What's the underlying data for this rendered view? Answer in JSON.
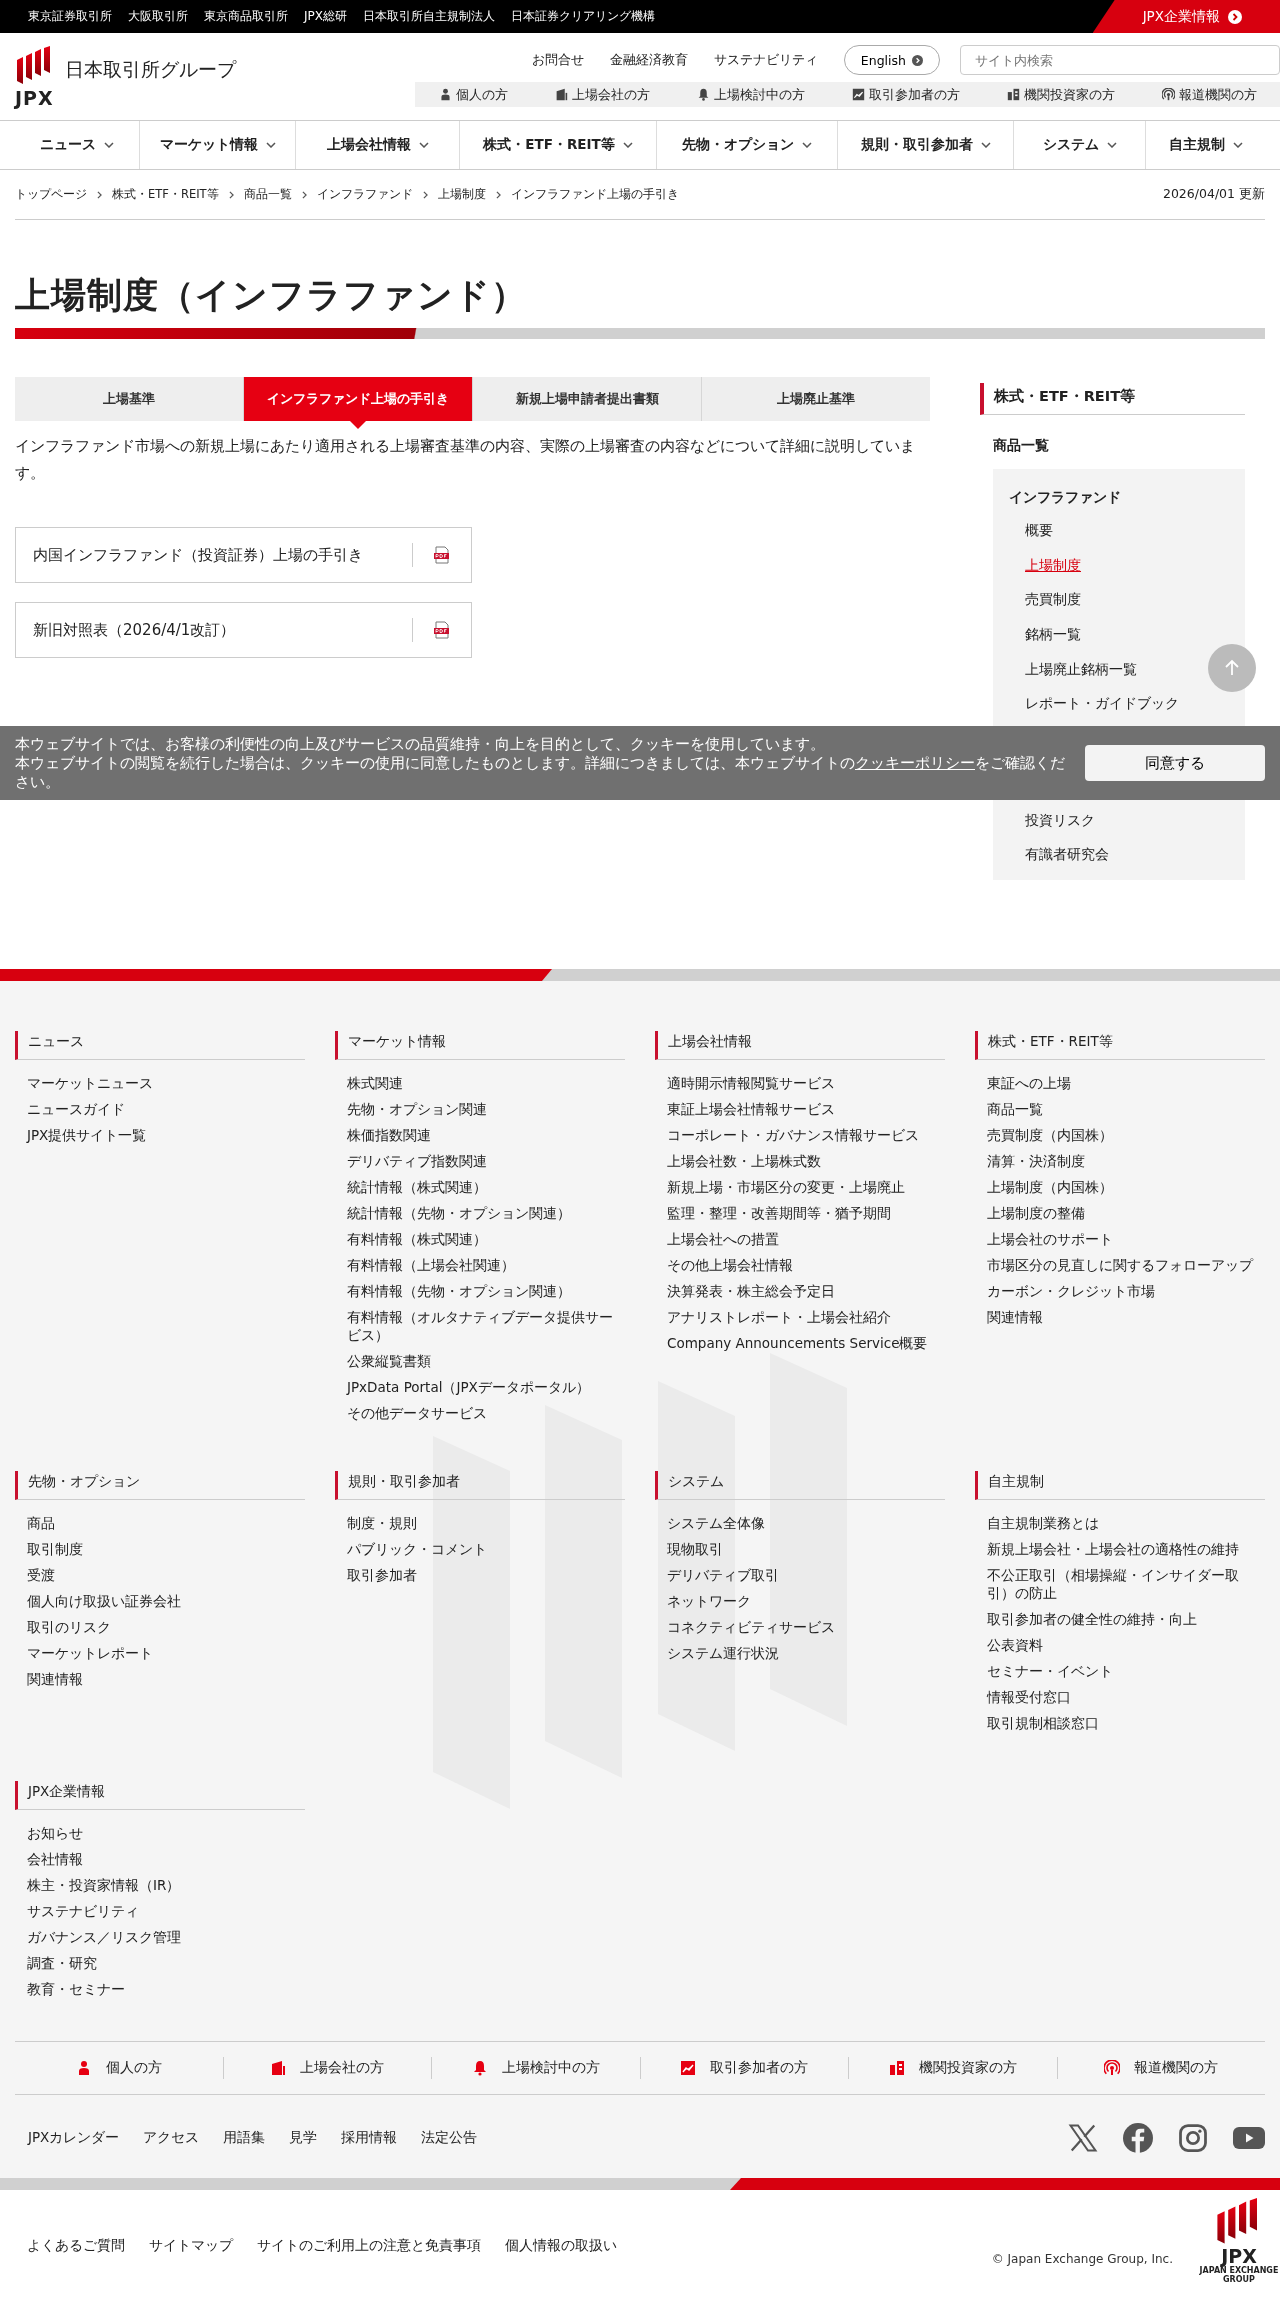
{
  "top_bar": {
    "links": [
      "東京証券取引所",
      "大阪取引所",
      "東京商品取引所",
      "JPX総研",
      "日本取引所自主規制法人",
      "日本証券クリアリング機構"
    ],
    "corporate_link": "JPX企業情報"
  },
  "header": {
    "logo_text": "JPX",
    "group_name": "日本取引所グループ",
    "utility_links": [
      "お問合せ",
      "金融経済教育",
      "サステナビリティ"
    ],
    "language_button": "English",
    "search": {
      "placeholder": "サイト内検索"
    },
    "audience_links": [
      {
        "label": "個人の方",
        "kind": "person"
      },
      {
        "label": "上場会社の方",
        "kind": "building"
      },
      {
        "label": "上場検討中の方",
        "kind": "bell"
      },
      {
        "label": "取引参加者の方",
        "kind": "chart"
      },
      {
        "label": "機関投資家の方",
        "kind": "institution"
      },
      {
        "label": "報道機関の方",
        "kind": "broadcast"
      }
    ]
  },
  "main_nav": [
    "ニュース",
    "マーケット情報",
    "上場会社情報",
    "株式・ETF・REIT等",
    "先物・オプション",
    "規則・取引参加者",
    "システム",
    "自主規制"
  ],
  "breadcrumb": [
    "トップページ",
    "株式・ETF・REIT等",
    "商品一覧",
    "インフラファンド",
    "上場制度",
    "インフラファンド上場の手引き"
  ],
  "updated": "2026/04/01 更新",
  "page_title": "上場制度（インフラファンド）",
  "tabs": [
    {
      "label": "上場基準",
      "selected": false
    },
    {
      "label": "インフラファンド上場の手引き",
      "selected": true
    },
    {
      "label": "新規上場申請者提出書類",
      "selected": false
    },
    {
      "label": "上場廃止基準",
      "selected": false
    }
  ],
  "description": "インフラファンド市場への新規上場にあたり適用される上場審査基準の内容、実際の上場審査の内容などについて詳細に説明しています。",
  "documents": [
    {
      "title": "内国インフラファンド（投資証券）上場の手引き"
    },
    {
      "title": "新旧対照表（2026/4/1改訂）"
    }
  ],
  "sidebar": {
    "heading": "株式・ETF・REIT等",
    "items": [
      {
        "label": "商品一覧",
        "children": [
          {
            "label": "インフラファンド",
            "children": [
              {
                "label": "概要",
                "selected": false
              },
              {
                "label": "上場制度",
                "selected": true
              },
              {
                "label": "売買制度",
                "selected": false
              },
              {
                "label": "銘柄一覧",
                "selected": false
              },
              {
                "label": "上場廃止銘柄一覧",
                "selected": false
              },
              {
                "label": "レポート・ガイドブック",
                "selected": false
              },
              {
                "label": "投資リスク",
                "selected": false
              },
              {
                "label": "有識者研究会",
                "selected": false
              }
            ]
          }
        ]
      }
    ]
  },
  "cookie_banner": {
    "sentence": "本ウェブサイトでは、お客様の利便性の向上及びサービスの品質維持・向上を目的として、クッキーを使用しています。",
    "before_link": "本ウェブサイトの閲覧を続行した場合は、クッキーの使用に同意したものとします。詳細につきましては、本ウェブサイトの",
    "link": "クッキーポリシー",
    "after_link": "をご確認ください。",
    "agree_button": "同意する"
  },
  "footer": {
    "sitemap": [
      {
        "heading": "ニュース",
        "links": [
          "マーケットニュース",
          "ニュースガイド",
          "JPX提供サイト一覧"
        ]
      },
      {
        "heading": "マーケット情報",
        "links": [
          "株式関連",
          "先物・オプション関連",
          "株価指数関連",
          "デリバティブ指数関連",
          "統計情報（株式関連）",
          "統計情報（先物・オプション関連）",
          "有料情報（株式関連）",
          "有料情報（上場会社関連）",
          "有料情報（先物・オプション関連）",
          "有料情報（オルタナティブデータ提供サービス）",
          "公衆縦覧書類",
          "JPxData Portal（JPXデータポータル）",
          "その他データサービス"
        ]
      },
      {
        "heading": "上場会社情報",
        "links": [
          "適時開示情報閲覧サービス",
          "東証上場会社情報サービス",
          "コーポレート・ガバナンス情報サービス",
          "上場会社数・上場株式数",
          "新規上場・市場区分の変更・上場廃止",
          "監理・整理・改善期間等・猶予期間",
          "上場会社への措置",
          "その他上場会社情報",
          "決算発表・株主総会予定日",
          "アナリストレポート・上場会社紹介",
          "Company Announcements Service概要"
        ]
      },
      {
        "heading": "株式・ETF・REIT等",
        "links": [
          "東証への上場",
          "商品一覧",
          "売買制度（内国株）",
          "清算・決済制度",
          "上場制度（内国株）",
          "上場制度の整備",
          "上場会社のサポート",
          "市場区分の見直しに関するフォローアップ",
          "カーボン・クレジット市場",
          "関連情報"
        ]
      },
      {
        "heading": "先物・オプション",
        "links": [
          "商品",
          "取引制度",
          "受渡",
          "個人向け取扱い証券会社",
          "取引のリスク",
          "マーケットレポート",
          "関連情報"
        ]
      },
      {
        "heading": "規則・取引参加者",
        "links": [
          "制度・規則",
          "パブリック・コメント",
          "取引参加者"
        ]
      },
      {
        "heading": "システム",
        "links": [
          "システム全体像",
          "現物取引",
          "デリバティブ取引",
          "ネットワーク",
          "コネクティビティサービス",
          "システム運行状況"
        ]
      },
      {
        "heading": "自主規制",
        "links": [
          "自主規制業務とは",
          "新規上場会社・上場会社の適格性の維持",
          "不公正取引（相場操縦・インサイダー取引）の防止",
          "取引参加者の健全性の維持・向上",
          "公表資料",
          "セミナー・イベント",
          "情報受付窓口",
          "取引規制相談窓口"
        ]
      },
      {
        "heading": "JPX企業情報",
        "links": [
          "お知らせ",
          "会社情報",
          "株主・投資家情報（IR）",
          "サステナビリティ",
          "ガバナンス／リスク管理",
          "調査・研究",
          "教育・セミナー"
        ]
      }
    ],
    "audience_links": [
      {
        "label": "個人の方",
        "kind": "person"
      },
      {
        "label": "上場会社の方",
        "kind": "building"
      },
      {
        "label": "上場検討中の方",
        "kind": "bell"
      },
      {
        "label": "取引参加者の方",
        "kind": "chart"
      },
      {
        "label": "機関投資家の方",
        "kind": "institution"
      },
      {
        "label": "報道機関の方",
        "kind": "broadcast"
      }
    ],
    "links": [
      "JPXカレンダー",
      "アクセス",
      "用語集",
      "見学",
      "採用情報",
      "法定公告"
    ],
    "social_links": [
      {
        "kind": "x"
      },
      {
        "kind": "facebook"
      },
      {
        "kind": "instagram"
      },
      {
        "kind": "youtube"
      }
    ],
    "bottom_links": [
      "よくあるご質問",
      "サイトマップ",
      "サイトのご利用上の注意と免責事項",
      "個人情報の取扱い"
    ],
    "copyright": "© Japan Exchange Group, Inc.",
    "logo_text": "JPX",
    "logo_subtitle": "JAPAN EXCHANGE GROUP"
  }
}
